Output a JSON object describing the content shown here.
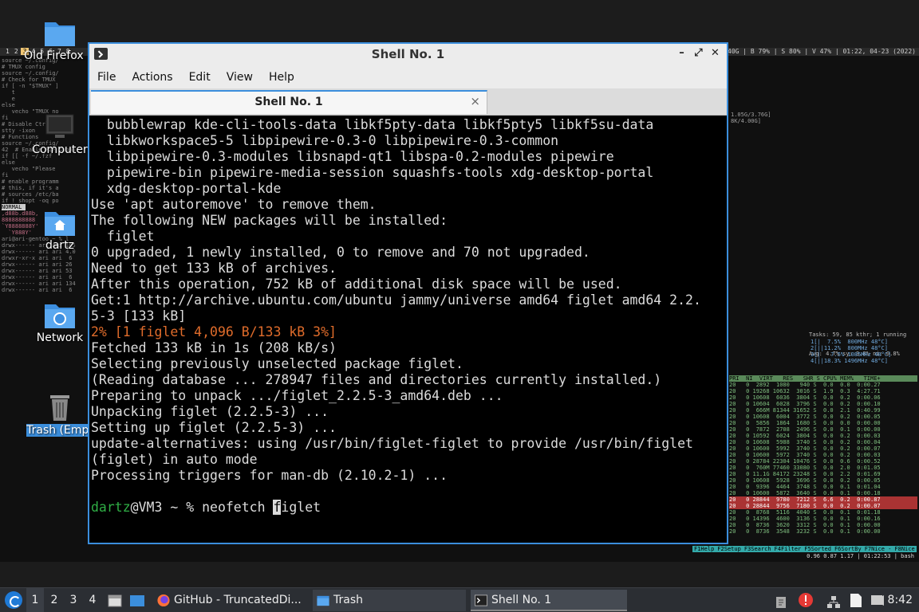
{
  "background": {
    "tmux_tabs": [
      "1",
      "2",
      "3",
      "4",
      "5",
      "6",
      "7",
      "8"
    ],
    "tmux_active_tab": "3",
    "status_right": "4Mi/3.8Gi | D 140G | B 79% | S 80% | V 47% | 01:22, 04-23 (2022)",
    "left_pane_lines": [
      "source ~/.config/",
      "",
      "# TMUX config",
      "source ~/.config/",
      "",
      "# Check for TMUX",
      "if [ -n \"$TMUX\" ]",
      "   t",
      "   e",
      "else",
      "   vecho \"TMUX no",
      "fi",
      "# Disable Ctrl",
      "stty -ixon",
      "",
      "# Functions",
      "source ~/.config/",
      "",
      "42  # Enable FZF suppo",
      "if [[ -f ~/.fzf",
      "",
      "",
      "else",
      "   vecho \"Please",
      "fi",
      "",
      "# enable programm",
      "# this, if it's a",
      "# sources /etc/ba",
      "if ! shopt -oq po",
      "NORMAL",
      "",
      ",d88b.d88b,",
      "8888888888",
      "`Y8888888Y'",
      "  `Y888Y'",
      "",
      "ari@ari-gentoo ~ % l",
      "drwx------ ari ari 105",
      "drwx------ ari ari 4.0",
      "drwxr-xr-x ari ari  6",
      "drwx------ ari ari 26",
      "drwx------ ari ari 53",
      "drwx------ ari ari  6",
      "drwx------ ari ari 134",
      "drwx------ ari ari  6"
    ],
    "htop_summary": "Tasks: 59, 85 kthr; 1 running",
    "htop_load": "Avg: 4.7% sy: 3.8% ni: 0.8%",
    "htop_mem": "1.05G/3.76G]",
    "htop_swap": "8K/4.00G]",
    "htop_cpu_lines": [
      "1[|  7.5%  800MHz 48°C]",
      "2[||11.2%  800MHz 48°C]",
      "3[|   7.5% 1085MHz 48°C]",
      "4[||18.3% 1496MHz 48°C]"
    ],
    "htop_columns": "PRI  NI  VIRT   RES   SHR S CPU% MEM%   TIME+",
    "htop_rows": [
      "20   0  2892  1080   940 S  0.0  0.0  0:00.27",
      "20   0 19268 10632  3016 S  1.9  0.3  4:27.71",
      "20   0 10608  6036  3804 S  0.0  0.2  0:00.06",
      "20   0 10604  6028  3796 S  0.0  0.2  0:00.10",
      "20   0  666M 81344 31652 S  0.0  2.1  0:40.99",
      "20   0 10608  6004  3772 S  0.0  0.2  0:00.05",
      "20   0  5856  1864  1680 S  0.0  0.0  0:00.00",
      "20   0  7872  2708  2496 S  0.0  0.1  0:00.00",
      "20   0 10592  6024  3804 S  0.0  0.2  0:00.03",
      "20   0 10608  5988  3740 S  0.0  0.2  0:00.04",
      "20   0 10600  5992  3740 S  0.0  0.2  0:00.07",
      "20   0 10600  5972  3740 S  0.0  0.2  0:00.03",
      "20   0 28784 22304 10476 S  0.0  0.6  0:00.52",
      "20   0  760M 77460 33080 S  0.0  2.0  0:01.05",
      "20   0 11.1G 84172 23248 S  0.0  2.2  0:01.69",
      "20   0 10608  5928  3696 S  0.0  0.2  0:00.05",
      "20   0  9396  4464  3748 S  0.0  0.1  0:01.04",
      "20   0 10600  5872  3640 S  0.0  0.1  0:00.18",
      "20   0 28844  9780  7212 S  6.6  0.2  0:00.87",
      "20   0 28844  9756  7180 S  0.0  0.2  0:00.07",
      "20   0  8768  5116  4040 S  0.0  0.1  0:01.18",
      "20   0 14396  4600  3136 S  0.0  0.1  0:00.16",
      "20   0  8736  3620  3312 S  0.0  0.1  0:00.00",
      "20   0  8736  3548  3232 S  0.0  0.1  0:00.00"
    ],
    "htop_fkeys": [
      "F1Help",
      "F2Setup",
      "F3Search",
      "F4Filter",
      "F5Sorted",
      "F6SortBy",
      "F7Nice -",
      "F8Nice"
    ],
    "bottom_status": "0.96 0.87 1.17 | 01:22:53 | bash"
  },
  "desktop_icons": [
    {
      "label": "Old Firefox D",
      "icon": "folder-icon"
    },
    {
      "label": "Computer",
      "icon": "computer-icon"
    },
    {
      "label": "dartz",
      "icon": "home-folder-icon"
    },
    {
      "label": "Network",
      "icon": "network-icon"
    },
    {
      "label": "Trash (Empt",
      "icon": "trash-icon"
    }
  ],
  "window": {
    "title": "Shell No. 1",
    "menu": [
      "File",
      "Actions",
      "Edit",
      "View",
      "Help"
    ],
    "tab_label": "Shell No. 1",
    "close_tab_glyph": "×",
    "ctrl_minimize": "–",
    "ctrl_maximize": "⤢",
    "ctrl_close": "✕"
  },
  "terminal": {
    "lines": [
      {
        "text": "  bubblewrap kde-cli-tools-data libkf5pty-data libkf5pty5 libkf5su-data",
        "style": ""
      },
      {
        "text": "  libkworkspace5-5 libpipewire-0.3-0 libpipewire-0.3-common",
        "style": ""
      },
      {
        "text": "  libpipewire-0.3-modules libsnapd-qt1 libspa-0.2-modules pipewire",
        "style": ""
      },
      {
        "text": "  pipewire-bin pipewire-media-session squashfs-tools xdg-desktop-portal",
        "style": ""
      },
      {
        "text": "  xdg-desktop-portal-kde",
        "style": ""
      },
      {
        "text": "Use 'apt autoremove' to remove them.",
        "style": ""
      },
      {
        "text": "The following NEW packages will be installed:",
        "style": ""
      },
      {
        "text": "  figlet",
        "style": ""
      },
      {
        "text": "0 upgraded, 1 newly installed, 0 to remove and 70 not upgraded.",
        "style": ""
      },
      {
        "text": "Need to get 133 kB of archives.",
        "style": ""
      },
      {
        "text": "After this operation, 752 kB of additional disk space will be used.",
        "style": ""
      },
      {
        "text": "Get:1 http://archive.ubuntu.com/ubuntu jammy/universe amd64 figlet amd64 2.2.",
        "style": ""
      },
      {
        "text": "5-3 [133 kB]",
        "style": ""
      },
      {
        "text": "2% [1 figlet 4,096 B/133 kB 3%]",
        "style": "orange"
      },
      {
        "text": "Fetched 133 kB in 1s (208 kB/s)",
        "style": ""
      },
      {
        "text": "Selecting previously unselected package figlet.",
        "style": ""
      },
      {
        "text": "(Reading database ... 278947 files and directories currently installed.)",
        "style": ""
      },
      {
        "text": "Preparing to unpack .../figlet_2.2.5-3_amd64.deb ...",
        "style": ""
      },
      {
        "text": "Unpacking figlet (2.2.5-3) ...",
        "style": ""
      },
      {
        "text": "Setting up figlet (2.2.5-3) ...",
        "style": ""
      },
      {
        "text": "update-alternatives: using /usr/bin/figlet-figlet to provide /usr/bin/figlet",
        "style": ""
      },
      {
        "text": "(figlet) in auto mode",
        "style": ""
      },
      {
        "text": "Processing triggers for man-db (2.10.2-1) ...",
        "style": ""
      },
      {
        "text": "",
        "style": ""
      }
    ],
    "prompt_user": "dartz",
    "prompt_rest": "@VM3 ~ % neofetch ",
    "cursor_char": "f",
    "after_cursor": "iglet"
  },
  "taskbar": {
    "workspaces": [
      "1",
      "2",
      "3",
      "4"
    ],
    "active_workspace": "1",
    "tasks": [
      {
        "label": "GitHub - TruncatedDi...",
        "icon": "firefox-icon"
      },
      {
        "label": "Trash",
        "icon": "folder-icon"
      },
      {
        "label": "Shell No. 1",
        "icon": "terminal-icon"
      }
    ],
    "clock": "8:42",
    "colors": {
      "accent": "#3b8edc",
      "prompt": "#2fae45",
      "progress": "#e06c2b"
    }
  }
}
